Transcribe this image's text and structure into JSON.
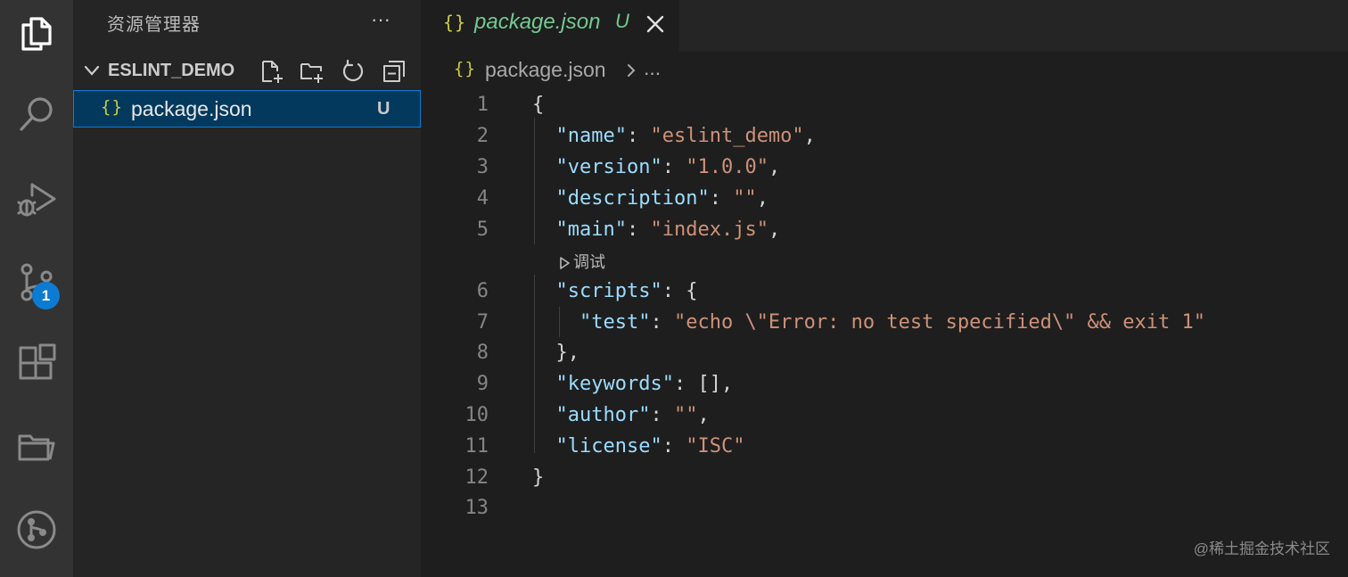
{
  "activity_bar": {
    "items": [
      {
        "name": "explorer-icon"
      },
      {
        "name": "search-icon"
      },
      {
        "name": "run-debug-icon"
      },
      {
        "name": "source-control-icon"
      },
      {
        "name": "extensions-icon"
      },
      {
        "name": "remote-explorer-icon"
      },
      {
        "name": "git-graph-icon"
      }
    ],
    "scm_badge": "1"
  },
  "sidebar": {
    "title": "资源管理器",
    "more_label": "···",
    "folder": {
      "name": "ESLINT_DEMO"
    },
    "file": {
      "icon": "{}",
      "name": "package.json",
      "status": "U"
    }
  },
  "editor": {
    "tab": {
      "icon": "{}",
      "label": "package.json",
      "status": "U"
    },
    "breadcrumb": {
      "icon": "{}",
      "file": "package.json",
      "more": "..."
    },
    "codelens": "调试",
    "line_numbers": [
      "1",
      "2",
      "3",
      "4",
      "5",
      "6",
      "7",
      "8",
      "9",
      "10",
      "11",
      "12",
      "13"
    ],
    "lines": [
      [
        {
          "t": "{",
          "c": "p"
        }
      ],
      [
        {
          "t": "  "
        },
        {
          "t": "\"name\"",
          "c": "k"
        },
        {
          "t": ": ",
          "c": "p"
        },
        {
          "t": "\"eslint_demo\"",
          "c": "s"
        },
        {
          "t": ",",
          "c": "p"
        }
      ],
      [
        {
          "t": "  "
        },
        {
          "t": "\"version\"",
          "c": "k"
        },
        {
          "t": ": ",
          "c": "p"
        },
        {
          "t": "\"1.0.0\"",
          "c": "s"
        },
        {
          "t": ",",
          "c": "p"
        }
      ],
      [
        {
          "t": "  "
        },
        {
          "t": "\"description\"",
          "c": "k"
        },
        {
          "t": ": ",
          "c": "p"
        },
        {
          "t": "\"\"",
          "c": "s"
        },
        {
          "t": ",",
          "c": "p"
        }
      ],
      [
        {
          "t": "  "
        },
        {
          "t": "\"main\"",
          "c": "k"
        },
        {
          "t": ": ",
          "c": "p"
        },
        {
          "t": "\"index.js\"",
          "c": "s"
        },
        {
          "t": ",",
          "c": "p"
        }
      ],
      [
        {
          "t": "  "
        },
        {
          "t": "\"scripts\"",
          "c": "k"
        },
        {
          "t": ": {",
          "c": "p"
        }
      ],
      [
        {
          "t": "    "
        },
        {
          "t": "\"test\"",
          "c": "k"
        },
        {
          "t": ": ",
          "c": "p"
        },
        {
          "t": "\"echo \\\"Error: no test specified\\\" && exit 1\"",
          "c": "s"
        }
      ],
      [
        {
          "t": "  "
        },
        {
          "t": "},",
          "c": "p"
        }
      ],
      [
        {
          "t": "  "
        },
        {
          "t": "\"keywords\"",
          "c": "k"
        },
        {
          "t": ": [],",
          "c": "p"
        }
      ],
      [
        {
          "t": "  "
        },
        {
          "t": "\"author\"",
          "c": "k"
        },
        {
          "t": ": ",
          "c": "p"
        },
        {
          "t": "\"\"",
          "c": "s"
        },
        {
          "t": ",",
          "c": "p"
        }
      ],
      [
        {
          "t": "  "
        },
        {
          "t": "\"license\"",
          "c": "k"
        },
        {
          "t": ": ",
          "c": "p"
        },
        {
          "t": "\"ISC\"",
          "c": "s"
        }
      ],
      [
        {
          "t": "}",
          "c": "p"
        }
      ],
      []
    ]
  },
  "watermark": "@稀土掘金技术社区",
  "colors": {
    "activity_bar": "#333333",
    "sidebar": "#252526",
    "editor": "#1e1e1e",
    "selection": "#04395e",
    "accent": "#0e7bd2",
    "untracked": "#73c991",
    "json_icon": "#cbcb41",
    "json_key": "#9cdcfe",
    "json_string": "#ce9178"
  }
}
